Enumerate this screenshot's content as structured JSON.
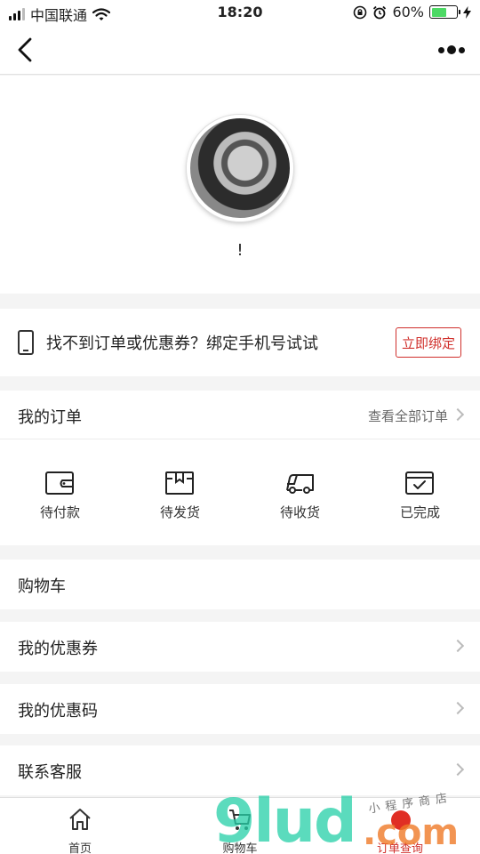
{
  "status_bar": {
    "carrier": "中国联通",
    "time": "18:20",
    "battery_percent": "60%",
    "battery_level": 0.6,
    "icons": [
      "signal-icon",
      "wifi-icon",
      "lock-rotation-icon",
      "alarm-icon",
      "battery-icon",
      "charging-icon"
    ]
  },
  "nav": {
    "back_icon": "chevron-left-icon",
    "more_icon": "more-dots-icon"
  },
  "profile": {
    "nickname": "!"
  },
  "bind": {
    "text": "找不到订单或优惠券？绑定手机号试试",
    "button": "立即绑定",
    "icon": "phone-icon"
  },
  "orders": {
    "title": "我的订单",
    "view_all": "查看全部订单",
    "items": [
      {
        "label": "待付款",
        "icon": "wallet-icon"
      },
      {
        "label": "待发货",
        "icon": "box-icon"
      },
      {
        "label": "待收货",
        "icon": "truck-icon"
      },
      {
        "label": "已完成",
        "icon": "check-box-icon"
      }
    ]
  },
  "menu": {
    "cart": "购物车",
    "coupons": "我的优惠券",
    "codes": "我的优惠码",
    "service": "联系客服"
  },
  "tabbar": {
    "items": [
      {
        "label": "首页",
        "icon": "home-icon"
      },
      {
        "label": "购物车",
        "icon": "cart-icon"
      },
      {
        "label": "订单查询",
        "icon": "order-icon"
      }
    ],
    "active_index": 2,
    "accent_color": "#d0302c"
  },
  "watermark": {
    "main": "9lud",
    "suffix": ".com",
    "sub": "小程序商店"
  }
}
